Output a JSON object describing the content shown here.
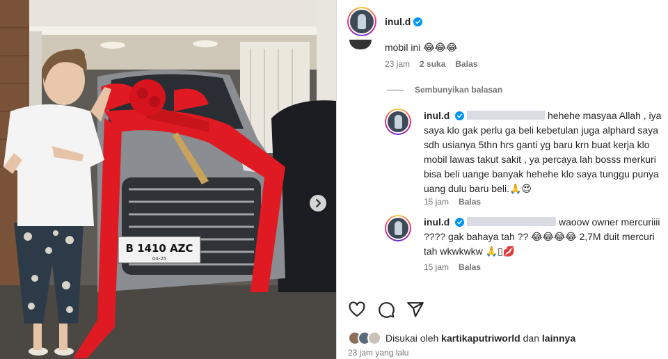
{
  "post": {
    "username": "inul.d",
    "verified": true,
    "license_plate": "B 1410 AZC",
    "plate_sub": "04-25"
  },
  "comments": {
    "partial_text": "mobil ini 😂😂😂",
    "partial_meta": {
      "time": "23 jam",
      "likes": "2 suka",
      "reply": "Balas"
    },
    "hide_replies": "Sembunyikan balasan",
    "replies": [
      {
        "username": "inul.d",
        "text": "hehehe masyaa Allah , iya saya klo gak perlu ga beli kebetulan juga alphard saya sdh usianya 5thn hrs ganti yg baru krn buat kerja klo mobil lawas takut sakit , ya percaya lah bosss merkuri bisa beli uange banyak hehehe klo saya tunggu punya uang dulu baru beli.🙏😍",
        "time": "15 jam",
        "reply": "Balas"
      },
      {
        "username": "inul.d",
        "text": "waoow owner mercuriiii ???? gak bahaya tah ?? 😂😂😂😂 2,7M duit mercuri tah wkwkwkw 🙏▯💋",
        "time": "15 jam",
        "reply": "Balas"
      }
    ]
  },
  "actions": {
    "icons": [
      "heart-icon",
      "comment-icon",
      "share-icon"
    ]
  },
  "likes": {
    "prefix": "Disukai oleh",
    "user": "kartikaputriworld",
    "joiner": "dan",
    "others": "lainnya"
  },
  "timestamp": "23 jam yang lalu",
  "colors": {
    "ribbon": "#e01a22",
    "verified": "#0095f6",
    "meta_gray": "#737373"
  }
}
